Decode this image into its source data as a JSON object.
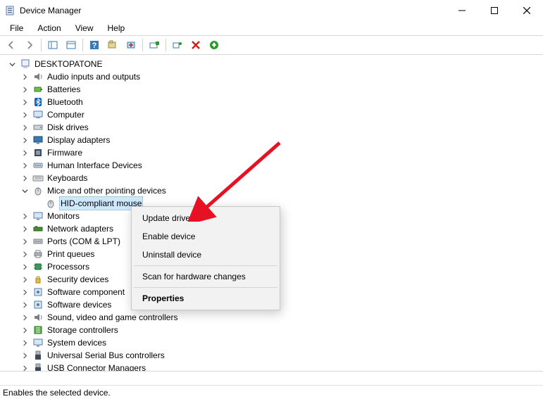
{
  "title": "Device Manager",
  "menus": {
    "file": "File",
    "action": "Action",
    "view": "View",
    "help": "Help"
  },
  "root": "DESKTOPATONE",
  "nodes": [
    {
      "label": "Audio inputs and outputs",
      "icon": "audio"
    },
    {
      "label": "Batteries",
      "icon": "battery"
    },
    {
      "label": "Bluetooth",
      "icon": "bluetooth"
    },
    {
      "label": "Computer",
      "icon": "computer"
    },
    {
      "label": "Disk drives",
      "icon": "disk"
    },
    {
      "label": "Display adapters",
      "icon": "display"
    },
    {
      "label": "Firmware",
      "icon": "firmware"
    },
    {
      "label": "Human Interface Devices",
      "icon": "hid"
    },
    {
      "label": "Keyboards",
      "icon": "keyboard"
    },
    {
      "label": "Mice and other pointing devices",
      "icon": "mouse",
      "expanded": true
    },
    {
      "label": "HID-compliant mouse",
      "icon": "mouse",
      "child": true,
      "selected": true
    },
    {
      "label": "Monitors",
      "icon": "monitor"
    },
    {
      "label": "Network adapters",
      "icon": "network"
    },
    {
      "label": "Ports (COM & LPT)",
      "icon": "port"
    },
    {
      "label": "Print queues",
      "icon": "printer"
    },
    {
      "label": "Processors",
      "icon": "cpu"
    },
    {
      "label": "Security devices",
      "icon": "security"
    },
    {
      "label": "Software component",
      "icon": "software"
    },
    {
      "label": "Software devices",
      "icon": "software"
    },
    {
      "label": "Sound, video and game controllers",
      "icon": "sound"
    },
    {
      "label": "Storage controllers",
      "icon": "storage"
    },
    {
      "label": "System devices",
      "icon": "system"
    },
    {
      "label": "Universal Serial Bus controllers",
      "icon": "usb"
    },
    {
      "label": "USB Connector Managers",
      "icon": "usb"
    }
  ],
  "context_menu": {
    "update": "Update driver",
    "enable": "Enable device",
    "uninstall": "Uninstall device",
    "scan": "Scan for hardware changes",
    "properties": "Properties"
  },
  "status": "Enables the selected device."
}
